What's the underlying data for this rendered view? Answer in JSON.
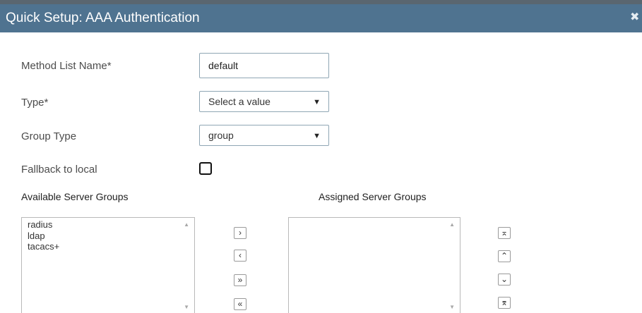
{
  "dialog": {
    "title": "Quick Setup: AAA Authentication",
    "close_glyph": "✖"
  },
  "form": {
    "method_list_name": {
      "label": "Method List Name*",
      "value": "default"
    },
    "type": {
      "label": "Type*",
      "value": "Select a value"
    },
    "group_type": {
      "label": "Group Type",
      "value": "group"
    },
    "fallback": {
      "label": "Fallback to local",
      "checked": false
    }
  },
  "available": {
    "header": "Available Server Groups",
    "items": [
      "radius",
      "ldap",
      "tacacs+"
    ]
  },
  "assigned": {
    "header": "Assigned Server Groups",
    "items": []
  },
  "transfer_buttons": {
    "move_right": "›",
    "move_left": "‹",
    "move_all_right": "»",
    "move_all_left": "«"
  },
  "order_buttons": {
    "move_top": "⌅",
    "move_up": "⌃",
    "move_down": "⌄",
    "move_bottom": "⌆"
  },
  "icons": {
    "caret": "▼",
    "scroll_up": "▲",
    "scroll_down": "▼"
  },
  "colors": {
    "title_bar": "#4f7390",
    "input_border": "#8fa6b4"
  }
}
